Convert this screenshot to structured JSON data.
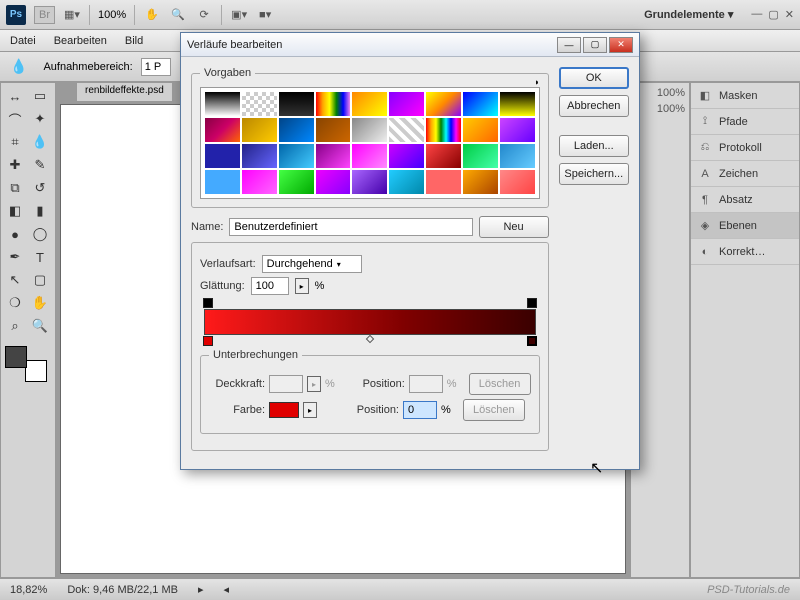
{
  "topbar": {
    "zoom": "100%",
    "workspace": "Grundelemente ▾"
  },
  "menu": [
    "Datei",
    "Bearbeiten",
    "Bild"
  ],
  "optbar": {
    "label": "Aufnahmebereich:",
    "value": "1 P"
  },
  "doc_tab": "renbildeffekte.psd",
  "panels": [
    {
      "icon": "◧",
      "label": "Masken"
    },
    {
      "icon": "⟟",
      "label": "Pfade"
    },
    {
      "icon": "⎌",
      "label": "Protokoll"
    },
    {
      "icon": "A",
      "label": "Zeichen"
    },
    {
      "icon": "¶",
      "label": "Absatz"
    },
    {
      "icon": "◈",
      "label": "Ebenen",
      "active": true
    },
    {
      "icon": "◐",
      "label": "Korrekt…"
    }
  ],
  "status": {
    "zoom": "18,82%",
    "dok": "Dok: 9,46 MB/22,1 MB"
  },
  "watermark": "PSD-Tutorials.de",
  "dialog": {
    "title": "Verläufe bearbeiten",
    "presets_label": "Vorgaben",
    "buttons": {
      "ok": "OK",
      "cancel": "Abbrechen",
      "load": "Laden...",
      "save": "Speichern...",
      "new": "Neu"
    },
    "name_label": "Name:",
    "name_value": "Benutzerdefiniert",
    "type_label": "Verlaufsart:",
    "type_value": "Durchgehend",
    "smooth_label": "Glättung:",
    "smooth_value": "100",
    "pct": "%",
    "stops_label": "Unterbrechungen",
    "opacity_label": "Deckkraft:",
    "position_label": "Position:",
    "color_label": "Farbe:",
    "delete": "Löschen",
    "position_value": "0"
  },
  "preset_gradients": [
    "linear-gradient(#000,#fff)",
    "repeating-conic-gradient(#ccc 0 25%,#fff 0 50%) 0/8px 8px",
    "linear-gradient(#000,#333)",
    "linear-gradient(90deg,red,orange,yellow,green,blue,violet)",
    "linear-gradient(135deg,#f80,#ff0)",
    "linear-gradient(135deg,#80f,#f0f)",
    "linear-gradient(135deg,#ff0,#f80,#80f)",
    "linear-gradient(135deg,#00f,#0ff)",
    "linear-gradient(#000,#ff0)",
    "linear-gradient(135deg,#804,#c06,#f60)",
    "linear-gradient(135deg,#b80,#fc0)",
    "linear-gradient(135deg,#048,#08f)",
    "linear-gradient(135deg,#840,#c60)",
    "linear-gradient(135deg,#888,#eee)",
    "repeating-linear-gradient(45deg,#ccc 0 4px,#fff 4px 8px)",
    "linear-gradient(90deg,red,orange,yellow,green,cyan,blue,magenta,red)",
    "linear-gradient(135deg,#fc0,#f60)",
    "linear-gradient(135deg,#c4f,#60f)",
    "linear-gradient(#22a,#22a)",
    "linear-gradient(135deg,#228,#66f)",
    "linear-gradient(135deg,#06a,#4cf)",
    "linear-gradient(135deg,#808,#f4f)",
    "linear-gradient(135deg,#f0f,#f8f)",
    "linear-gradient(135deg,#c0f,#40f)",
    "linear-gradient(135deg,#f44,#800)",
    "linear-gradient(135deg,#0c4,#4fa)",
    "linear-gradient(135deg,#28c,#6cf)",
    "linear-gradient(#4af,#4af)",
    "linear-gradient(135deg,#f0f,#f6f)",
    "linear-gradient(135deg,#4f4,#0a0)",
    "linear-gradient(135deg,#e0f,#80f)",
    "linear-gradient(135deg,#a6f,#40a)",
    "linear-gradient(135deg,#2cf,#08a)",
    "linear-gradient(#f66,#f66)",
    "linear-gradient(135deg,#fa0,#a40)",
    "linear-gradient(135deg,#f88,#f44)"
  ],
  "layers_mini": {
    "opacity": "100%",
    "fill": "100%"
  }
}
